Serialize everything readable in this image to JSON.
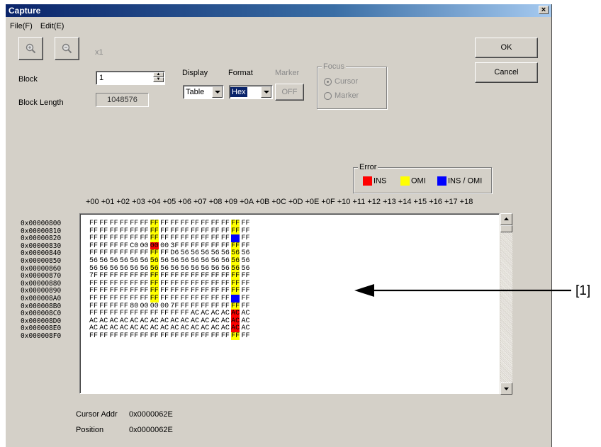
{
  "window": {
    "title": "Capture",
    "close_glyph": "×"
  },
  "menu": [
    {
      "label": "File(F)"
    },
    {
      "label": "Edit(E)"
    }
  ],
  "toolbar": {
    "zoom_in_icon": "zoom-in-icon",
    "zoom_out_icon": "zoom-out-icon",
    "zoom_level": "x1",
    "ok_label": "OK",
    "cancel_label": "Cancel"
  },
  "block": {
    "label": "Block",
    "value": "1"
  },
  "block_length": {
    "label": "Block Length",
    "value": "1048576"
  },
  "display": {
    "label": "Display",
    "value": "Table"
  },
  "format": {
    "label": "Format",
    "value": "Hex"
  },
  "marker": {
    "label": "Marker",
    "button": "OFF"
  },
  "focus": {
    "title": "Focus",
    "options": [
      {
        "label": "Cursor",
        "selected": true
      },
      {
        "label": "Marker",
        "selected": false
      }
    ]
  },
  "error_legend": {
    "title": "Error",
    "items": [
      {
        "label": "INS",
        "color": "#ff0000"
      },
      {
        "label": "OMI",
        "color": "#ffff00"
      },
      {
        "label": "INS / OMI",
        "color": "#0000ff"
      }
    ]
  },
  "column_headers": "+00 +01 +02 +03 +04 +05 +06 +07 +08 +09 +0A +0B +0C +0D +0E +0F +10 +11 +12 +13 +14 +15 +16 +17 +18",
  "dump": {
    "addresses": [
      "0x00000800",
      "0x00000810",
      "0x00000820",
      "0x00000830",
      "0x00000840",
      "0x00000850",
      "0x00000860",
      "0x00000870",
      "0x00000880",
      "0x00000890",
      "0x000008A0",
      "0x000008B0",
      "0x000008C0",
      "0x000008D0",
      "0x000008E0",
      "0x000008F0"
    ],
    "rows": [
      "FF FF FF FF FF FF FF FF FF FF FF FF FF FF FF FF",
      "FF FF FF FF FF FF FF FF FF FF FF FF FF FF FF FF",
      "FF FF FF FF FF FF FF FF FF FF FF FF FF FF FF FF",
      "FF FF FF FF C0 00 00 00 3F FF FF FF FF FF FF FF",
      "FF FF FF FF FF FF FF FF D6 56 56 56 56 56 56 56",
      "56 56 56 56 56 56 56 56 56 56 56 56 56 56 56 56",
      "56 56 56 56 56 56 56 56 56 56 56 56 56 56 56 56",
      "7F FF FF FF FF FF FF FF FF FF FF FF FF FF FF FF",
      "FF FF FF FF FF FF FF FF FF FF FF FF FF FF FF FF",
      "FF FF FF FF FF FF FF FF FF FF FF FF FF FF FF FF",
      "FF FF FF FF FF FF FF FF FF FF FF FF FF FF FF FF",
      "FF FF FF FF 80 00 00 00 7F FF FF FF FF FF FF FF",
      "FF FF FF FF FF FF FF FF FF FF AC AC AC AC AC AC",
      "AC AC AC AC AC AC AC AC AC AC AC AC AC AC AC AC",
      "AC AC AC AC AC AC AC AC AC AC AC AC AC AC AC AC",
      "FF FF FF FF FF FF FF FF FF FF FF FF FF FF FF FF"
    ],
    "highlights": [
      {
        "row": 0,
        "col": 6,
        "type": "yellow"
      },
      {
        "row": 0,
        "col": 14,
        "type": "yellow"
      },
      {
        "row": 1,
        "col": 6,
        "type": "yellow"
      },
      {
        "row": 1,
        "col": 14,
        "type": "yellow"
      },
      {
        "row": 2,
        "col": 6,
        "type": "yellow"
      },
      {
        "row": 2,
        "col": 14,
        "type": "blue"
      },
      {
        "row": 3,
        "col": 6,
        "type": "red"
      },
      {
        "row": 3,
        "col": 14,
        "type": "yellow"
      },
      {
        "row": 4,
        "col": 6,
        "type": "yellow"
      },
      {
        "row": 4,
        "col": 14,
        "type": "yellow"
      },
      {
        "row": 5,
        "col": 6,
        "type": "yellow"
      },
      {
        "row": 5,
        "col": 14,
        "type": "yellow"
      },
      {
        "row": 6,
        "col": 6,
        "type": "yellow"
      },
      {
        "row": 6,
        "col": 14,
        "type": "yellow"
      },
      {
        "row": 7,
        "col": 6,
        "type": "yellow"
      },
      {
        "row": 7,
        "col": 14,
        "type": "yellow"
      },
      {
        "row": 8,
        "col": 6,
        "type": "yellow"
      },
      {
        "row": 8,
        "col": 14,
        "type": "yellow"
      },
      {
        "row": 9,
        "col": 6,
        "type": "yellow"
      },
      {
        "row": 9,
        "col": 14,
        "type": "yellow"
      },
      {
        "row": 10,
        "col": 6,
        "type": "yellow"
      },
      {
        "row": 10,
        "col": 14,
        "type": "blue"
      },
      {
        "row": 11,
        "col": 14,
        "type": "yellow"
      },
      {
        "row": 12,
        "col": 14,
        "type": "red"
      },
      {
        "row": 13,
        "col": 14,
        "type": "red"
      },
      {
        "row": 14,
        "col": 14,
        "type": "red"
      },
      {
        "row": 15,
        "col": 14,
        "type": "yellow"
      }
    ]
  },
  "status": {
    "cursor_addr_label": "Cursor Addr",
    "cursor_addr_value": "0x0000062E",
    "position_label": "Position",
    "position_value": "0x0000062E"
  },
  "annotation": {
    "label": "[1]"
  }
}
